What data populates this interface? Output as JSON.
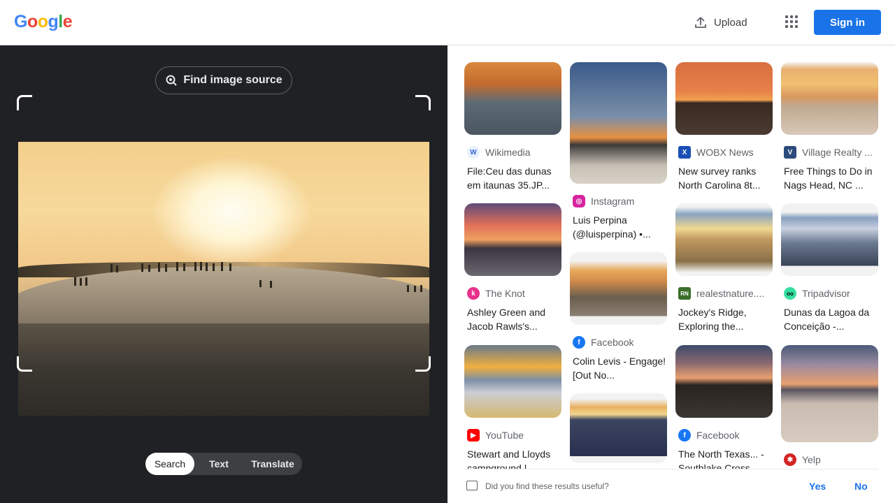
{
  "header": {
    "logo_letters": [
      "G",
      "o",
      "o",
      "g",
      "l",
      "e"
    ],
    "logo_colors": [
      "#4285f4",
      "#ea4335",
      "#fbbc05",
      "#4285f4",
      "#34a853",
      "#ea4335"
    ],
    "upload_label": "Upload",
    "apps_icon": "apps-grid-icon",
    "signin_label": "Sign in"
  },
  "lens": {
    "find_source_label": "Find image source",
    "modes": [
      "Search",
      "Text",
      "Translate"
    ],
    "active_mode": "Search"
  },
  "results": [
    {
      "source": "Wikimedia",
      "title": "File:Ceu das dunas em itaunas 35.JP...",
      "favicon_color": "#e8f0fe",
      "favicon_fg": "#3367d6",
      "favicon": "W"
    },
    {
      "source": "Instagram",
      "title": "Luis Perpina (@luisperpina) •...",
      "favicon_color": "#d6249f",
      "favicon_fg": "#ffffff",
      "favicon": "◎"
    },
    {
      "source": "WOBX News",
      "title": "New survey ranks North Carolina 8t...",
      "favicon_color": "#1a4fb5",
      "favicon_fg": "#ffffff",
      "favicon": "X"
    },
    {
      "source": "Village Realty ...",
      "title": "Free Things to Do in Nags Head, NC ...",
      "favicon_color": "#2c4a7c",
      "favicon_fg": "#ffffff",
      "favicon": "V"
    },
    {
      "source": "The Knot",
      "title": "Ashley Green and Jacob Rawls's...",
      "favicon_color": "#e8308c",
      "favicon_fg": "#ffffff",
      "favicon": "k"
    },
    {
      "source": "Facebook",
      "title": "Colin Levis - Engage! [Out No...",
      "favicon_color": "#1877f2",
      "favicon_fg": "#ffffff",
      "favicon": "f"
    },
    {
      "source": "realestnature....",
      "title": "Jockey's Ridge, Exploring the...",
      "favicon_color": "#3b6e2a",
      "favicon_fg": "#ffffff",
      "favicon": "RN"
    },
    {
      "source": "Tripadvisor",
      "title": "Dunas da Lagoa da Conceição -...",
      "favicon_color": "#34e0a1",
      "favicon_fg": "#000000",
      "favicon": "oo"
    },
    {
      "source": "YouTube",
      "title": "Stewart and Lloyds campground |...",
      "favicon_color": "#ff0000",
      "favicon_fg": "#ffffff",
      "favicon": "▶"
    },
    {
      "source": "Facebook",
      "title": "The North Texas... - Southlake Cross...",
      "favicon_color": "#1877f2",
      "favicon_fg": "#ffffff",
      "favicon": "f"
    },
    {
      "source": "Yelp",
      "title": "",
      "favicon_color": "#d32323",
      "favicon_fg": "#ffffff",
      "favicon": "✱"
    }
  ],
  "feedback": {
    "question": "Did you find these results useful?",
    "yes_label": "Yes",
    "no_label": "No"
  }
}
